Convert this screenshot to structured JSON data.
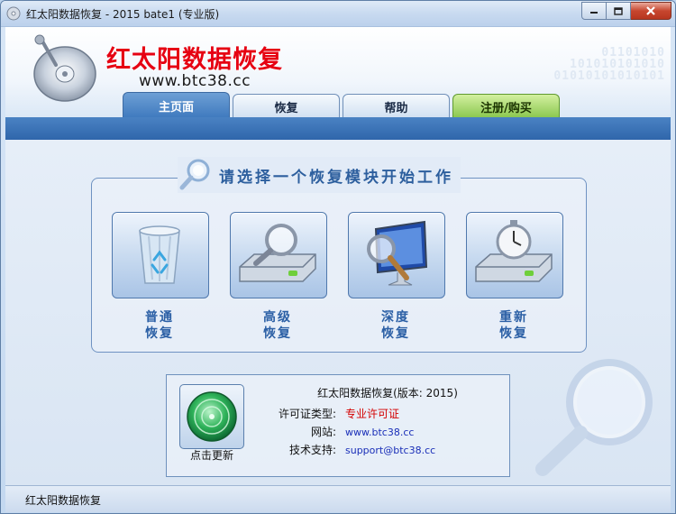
{
  "window": {
    "title": "红太阳数据恢复 - 2015 bate1 (专业版)",
    "icons": {
      "app": "disk-icon",
      "minimize": "minimize-icon",
      "maximize": "maximize-icon",
      "close": "close-icon"
    }
  },
  "banner": {
    "brand_title": "红太阳数据恢复",
    "brand_url": "www.btc38.cc",
    "binary_lines": [
      "01101010",
      "101010101010",
      "01010101010101",
      "110101010101"
    ]
  },
  "tabs": [
    {
      "label": "主页面",
      "active": true
    },
    {
      "label": "恢复",
      "active": false
    },
    {
      "label": "帮助",
      "active": false
    },
    {
      "label": "注册/购买",
      "active": false
    }
  ],
  "panel": {
    "title": "请选择一个恢复模块开始工作",
    "modules": [
      {
        "label_line1": "普通",
        "label_line2": "恢复",
        "icon": "recycle-bin-icon"
      },
      {
        "label_line1": "高级",
        "label_line2": "恢复",
        "icon": "magnifier-drive-icon"
      },
      {
        "label_line1": "深度",
        "label_line2": "恢复",
        "icon": "monitor-magnifier-icon"
      },
      {
        "label_line1": "重新",
        "label_line2": "恢复",
        "icon": "stopwatch-drive-icon"
      }
    ]
  },
  "info": {
    "title": "红太阳数据恢复(版本: 2015)",
    "update_label": "点击更新",
    "license_key": "许可证类型:",
    "license_value": "专业许可证",
    "website_key": "网站:",
    "website_value": "www.btc38.cc",
    "support_key": "技术支持:",
    "support_value": "support@btc38.cc"
  },
  "status": {
    "text": "红太阳数据恢复"
  },
  "colors": {
    "brand_red": "#e60012",
    "tab_blue": "#3d78bd",
    "buy_green": "#86c54a",
    "license_red": "#d40000",
    "link_blue": "#1a2fb8"
  }
}
